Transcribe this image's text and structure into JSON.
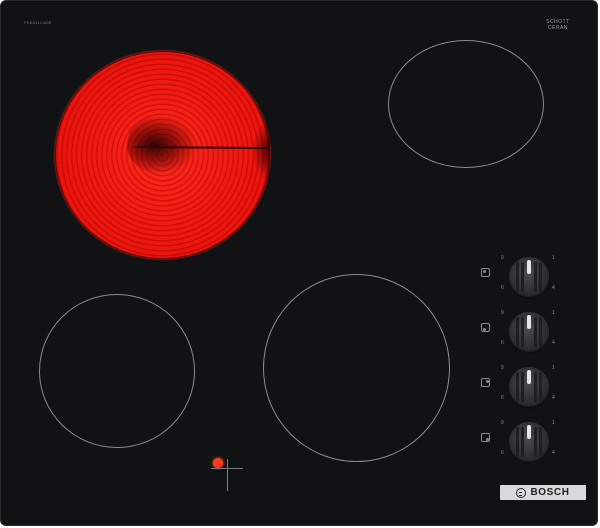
{
  "product": {
    "model_code": "PKE611CA3E",
    "glass_brand": "SCHOTT",
    "glass_sub": "CERAN",
    "glass_mark": "®",
    "brand": "BOSCH"
  },
  "zones": [
    {
      "id": "front-left",
      "state": "off"
    },
    {
      "id": "rear-left",
      "state": "on"
    },
    {
      "id": "rear-right",
      "state": "off"
    },
    {
      "id": "front-center",
      "state": "off"
    }
  ],
  "residual_heat_indicator": {
    "state": "on",
    "color": "#ff3a1a"
  },
  "knobs": [
    {
      "label": "rear-left-zone-knob"
    },
    {
      "label": "front-left-zone-knob"
    },
    {
      "label": "rear-right-zone-knob"
    },
    {
      "label": "front-center-zone-knob"
    }
  ],
  "knob_scale": [
    "0",
    "1",
    "2",
    "3",
    "4",
    "5",
    "6",
    "7",
    "8",
    "9"
  ],
  "colors": {
    "glass": "#111214",
    "hot_zone": "#f0180f",
    "ring": "#8a8b90",
    "brand_plate": "#d8d9db"
  }
}
